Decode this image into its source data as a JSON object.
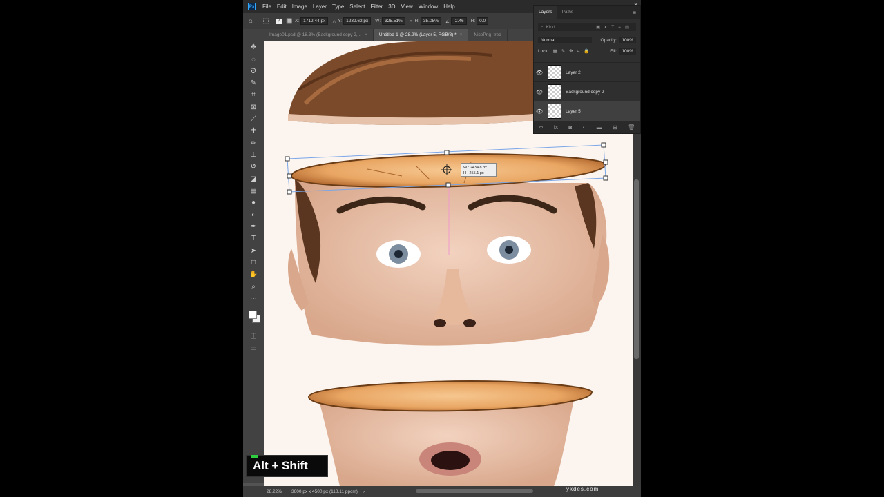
{
  "menu": [
    "File",
    "Edit",
    "Image",
    "Layer",
    "Type",
    "Select",
    "Filter",
    "3D",
    "View",
    "Window",
    "Help"
  ],
  "options": {
    "x_label": "X:",
    "x_value": "1712.44 px",
    "y_label": "Y:",
    "y_value": "1239.62 px",
    "w_label": "W:",
    "w_value": "325.51%",
    "h_label": "H:",
    "h_value": "35.05%",
    "angle_value": "-2.46",
    "hskew_label": "H:",
    "hskew_value": "0.0"
  },
  "tabs": [
    {
      "label": "Image01.psd @ 18.3% (Background copy 2,..."
    },
    {
      "label": "Untitled-1 @ 28.2% (Layer 5, RGB/8) *"
    },
    {
      "label": "NicePng_tree"
    }
  ],
  "transform_readout": {
    "w": "W : 2434.8 px",
    "h": "H :   255.1 px"
  },
  "layers_panel": {
    "tabs": [
      "Layers",
      "Paths"
    ],
    "kind_placeholder": "Kind",
    "blend_mode": "Normal",
    "opacity_label": "Opacity:",
    "opacity_value": "100%",
    "lock_label": "Lock:",
    "fill_label": "Fill:",
    "fill_value": "100%",
    "layers": [
      {
        "name": "Layer 2"
      },
      {
        "name": "Background copy 2"
      },
      {
        "name": "Layer 5"
      }
    ]
  },
  "status": {
    "zoom": "28.22%",
    "doc_info": "3600 px x 4500 px (118.11 ppcm)"
  },
  "overlay": {
    "shortcut": "Alt + Shift"
  },
  "watermark": "ykdes.com",
  "colors": {
    "accent": "#31a8ff",
    "indicator": "#2ecc40"
  }
}
